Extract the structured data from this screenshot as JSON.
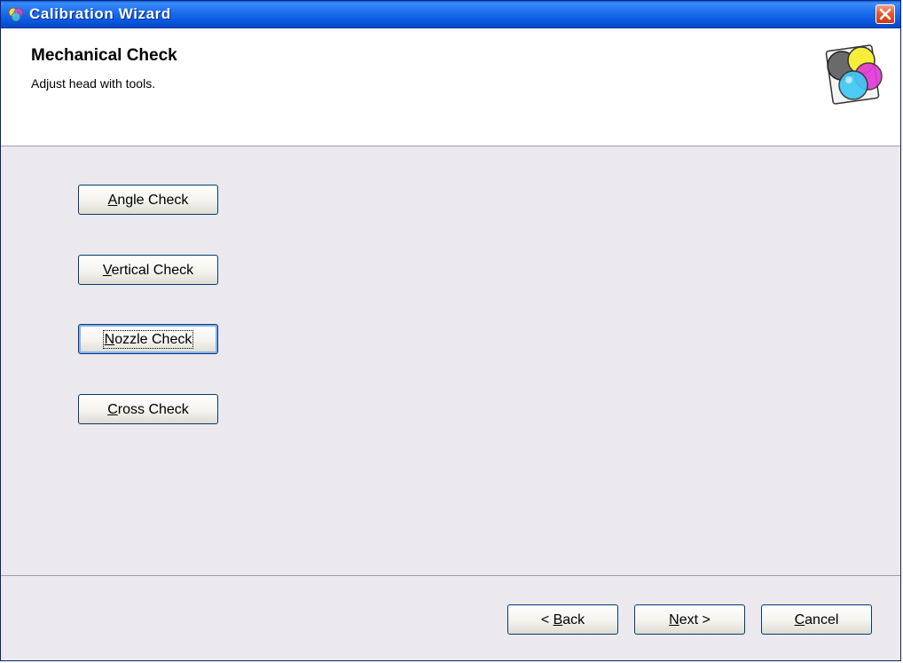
{
  "window": {
    "title": "Calibration Wizard",
    "close_label": "×"
  },
  "header": {
    "title": "Mechanical Check",
    "subtitle": "Adjust head with tools."
  },
  "checks": [
    {
      "mnemonic": "A",
      "rest": "ngle Check"
    },
    {
      "mnemonic": "V",
      "rest": "ertical Check"
    },
    {
      "mnemonic": "N",
      "rest": "ozzle Check",
      "focused": true
    },
    {
      "mnemonic": "C",
      "rest": "ross Check"
    }
  ],
  "footer": {
    "back": {
      "prefix": "< ",
      "mnemonic": "B",
      "rest": "ack"
    },
    "next": {
      "prefix": "",
      "mnemonic": "N",
      "rest": "ext >"
    },
    "cancel": {
      "prefix": "",
      "mnemonic": "C",
      "rest": "ancel"
    }
  },
  "colors": {
    "titlebar": "#0a5ee6",
    "content_bg": "#ebe9ed",
    "button_border": "#003c74"
  }
}
